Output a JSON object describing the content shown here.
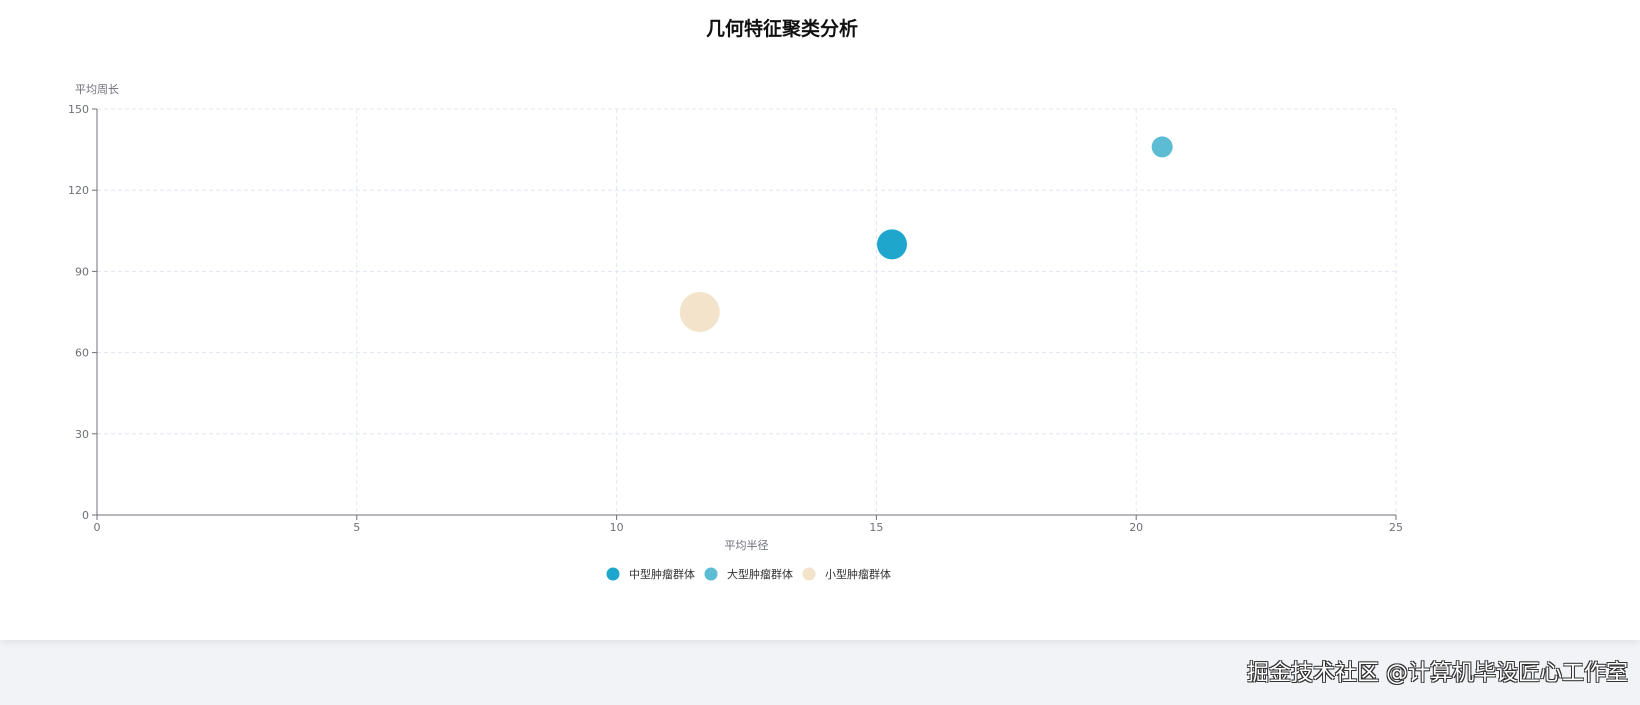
{
  "chart_data": {
    "type": "scatter",
    "title": "几何特征聚类分析",
    "xlabel": "平均半径",
    "ylabel": "平均周长",
    "xlim": [
      0,
      25
    ],
    "ylim": [
      0,
      150
    ],
    "xticks": [
      0,
      5,
      10,
      15,
      20,
      25
    ],
    "yticks": [
      0,
      30,
      60,
      90,
      120,
      150
    ],
    "grid": true,
    "legend_position": "bottom-center",
    "series": [
      {
        "name": "中型肿瘤群体",
        "color": "#1fa6cd",
        "points": [
          {
            "x": 15.3,
            "y": 100,
            "size": 30
          }
        ]
      },
      {
        "name": "大型肿瘤群体",
        "color": "#5bbcd3",
        "points": [
          {
            "x": 20.5,
            "y": 136,
            "size": 21
          }
        ]
      },
      {
        "name": "小型肿瘤群体",
        "color": "#f2e3ca",
        "points": [
          {
            "x": 11.6,
            "y": 75,
            "size": 40
          }
        ]
      }
    ]
  },
  "watermark": "掘金技术社区 @计算机毕设匠心工作室"
}
